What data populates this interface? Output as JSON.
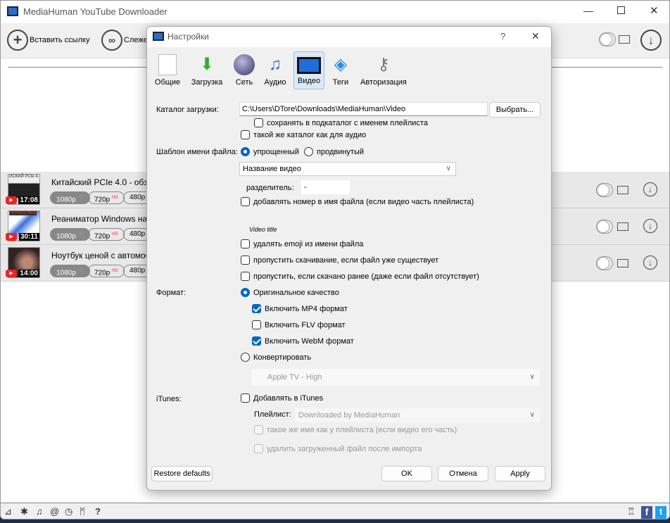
{
  "app": {
    "title": "MediaHuman YouTube Downloader"
  },
  "toolbar": {
    "paste_link": "Вставить ссылку",
    "track": "Слеже"
  },
  "items": [
    {
      "title": "Китайский PCIe 4.0 - обзор",
      "duration": "17:08",
      "thumb_text": "ИСКИЙ PCIe 4.",
      "q": [
        "1080p",
        "720p",
        "480p"
      ]
    },
    {
      "title": "Реаниматор Windows на фл",
      "duration": "30:11",
      "thumb_text": "РЕННАЯ ФЛЕ",
      "q": [
        "1080p",
        "720p",
        "480p"
      ]
    },
    {
      "title": "Ноутбук ценой с автомоби",
      "duration": "14:00",
      "thumb_text": "",
      "q": [
        "1080p",
        "720p",
        "480p"
      ]
    }
  ],
  "hd": "HD",
  "dialog": {
    "title": "Настройки",
    "help": "?",
    "close": "✕",
    "tabs": [
      {
        "label": "Общие",
        "icon": "switch-icon"
      },
      {
        "label": "Загрузка",
        "icon": "download-arrow-icon"
      },
      {
        "label": "Сеть",
        "icon": "globe-icon"
      },
      {
        "label": "Аудио",
        "icon": "music-note-icon"
      },
      {
        "label": "Видео",
        "icon": "film-icon",
        "active": true
      },
      {
        "label": "Теги",
        "icon": "tag-icon"
      },
      {
        "label": "Авторизация",
        "icon": "keys-icon"
      }
    ],
    "dir_label": "Каталог загрузки:",
    "dir_value": "C:\\Users\\DTore\\Downloads\\MediaHuman\\Video",
    "browse": "Выбрать...",
    "subdir": "сохранять в подкаталог с именем плейлиста",
    "same_dir": "такой же каталог как для аудио",
    "template_label": "Шаблон имени файла:",
    "simple": "упрощенный",
    "advanced": "продвинутый",
    "template_value": "Название видео",
    "separator_label": "разделитель:",
    "separator_value": "-",
    "add_number": "добавлять номер в имя файла (если видео часть плейлиста)",
    "preview": "Video title",
    "remove_emoji": "удалять emoji из имени файла",
    "skip_exists": "пропустить скачивание, если файл уже существует",
    "skip_downloaded": "пропустить, если скачано ранее (даже если файл отсутствует)",
    "format_label": "Формат:",
    "original": "Оригинальное качество",
    "mp4": "Включить MP4 формат",
    "flv": "Включить FLV формат",
    "webm": "Включить WebM формат",
    "convert": "Конвертировать",
    "convert_preset": "Apple TV - High",
    "itunes_label": "iTunes:",
    "add_itunes": "Добавлять в iTunes",
    "playlist_label": "Плейлист:",
    "playlist_value": "Downloaded by MediaHuman",
    "same_name": "такое же имя как у плейлиста (если видео его часть)",
    "delete_after": "удалить загруженный файл после импорта",
    "restore": "Restore defaults",
    "ok": "OK",
    "cancel": "Отмена",
    "apply": "Apply"
  },
  "status_icons": [
    "broom-icon",
    "gear-icon",
    "music-icon",
    "snail-icon",
    "clock-icon",
    "binoculars-icon",
    "help-icon"
  ],
  "status_glyphs": {
    "help": "?"
  },
  "social": {
    "fb": "f",
    "tw": "t"
  },
  "colors": {
    "accent": "#0067c0",
    "youtube": "#e22222"
  }
}
